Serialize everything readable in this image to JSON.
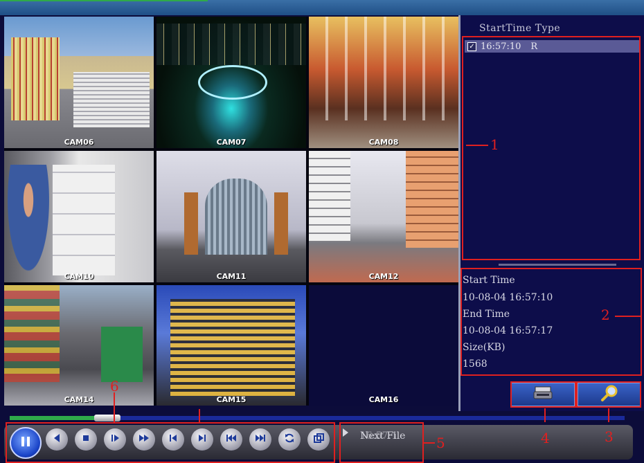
{
  "cameras": [
    {
      "label": "CAM06",
      "scene": "modern building with striped facade"
    },
    {
      "label": "CAM07",
      "scene": "city at night with lit stadium"
    },
    {
      "label": "CAM08",
      "scene": "shopping mall interior"
    },
    {
      "label": "CAM10",
      "scene": "warehouse with boxes"
    },
    {
      "label": "CAM11",
      "scene": "modern glass building"
    },
    {
      "label": "CAM12",
      "scene": "apartment blocks courtyard"
    },
    {
      "label": "CAM14",
      "scene": "busy street with signs"
    },
    {
      "label": "CAM15",
      "scene": "office tower at dusk"
    },
    {
      "label": "CAM16",
      "scene": "empty"
    }
  ],
  "file_list": {
    "header": "StartTime Type",
    "rows": [
      {
        "time": "16:57:10",
        "type": "R",
        "checked": true
      }
    ]
  },
  "file_info": {
    "start_label": "Start Time",
    "start_value": "10-08-04 16:57:10",
    "end_label": "End Time",
    "end_value": "10-08-04 16:57:17",
    "size_label": "Size(KB)",
    "size_value": "1568"
  },
  "buttons": {
    "backup_icon": "backup-drive-icon",
    "search_icon": "magnifier-icon"
  },
  "playback": {
    "progress": 0.14,
    "controls": [
      "pause",
      "reverse-play",
      "stop",
      "slow-forward",
      "fast-forward",
      "previous-frame",
      "next-frame",
      "previous-file",
      "next-file",
      "loop",
      "fullscreen"
    ],
    "next_file_label": "Next File",
    "next_file_overlay": "16:57:1"
  },
  "callouts": [
    "1",
    "2",
    "3",
    "4",
    "5",
    "6"
  ],
  "colors": {
    "accent_red": "#e02020",
    "panel_bg": "#0d0d4a",
    "progress_fill": "#2faa4a",
    "progress_bg": "#1a2a9a"
  }
}
